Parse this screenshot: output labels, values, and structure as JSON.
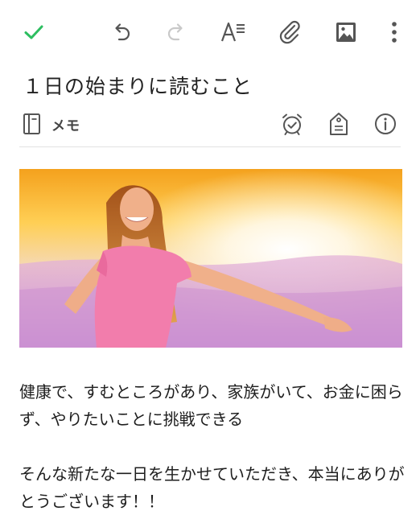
{
  "toolbar": {
    "done": "checkmark-icon",
    "undo": "undo-icon",
    "redo": "redo-icon",
    "format": "text-format-icon",
    "attach": "paperclip-icon",
    "image": "image-icon",
    "more": "more-vertical-icon"
  },
  "note": {
    "title": "１日の始まりに読むこと",
    "notebook": "メモ",
    "paragraph1": "健康で、すむところがあり、家族がいて、お金に困らず、やりたいことに挑戦できる",
    "paragraph2": "そんな新たな一日を生かせていただき、本当にありがとうございます！！"
  },
  "colors": {
    "accent_green": "#2dbe60",
    "icon_gray": "#555555",
    "disabled_gray": "#c9c9c9"
  }
}
